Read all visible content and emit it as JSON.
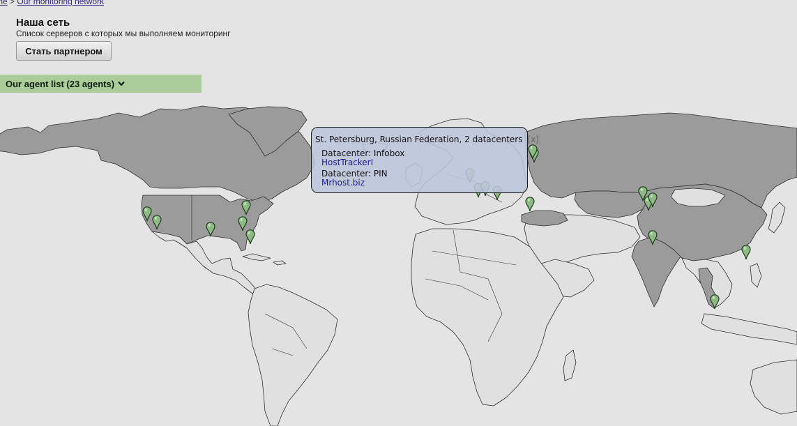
{
  "breadcrumb": {
    "home": "me",
    "separator": ">",
    "current": "Our monitoring network"
  },
  "header": {
    "title": "Наша сеть",
    "subtitle": "Список серверов с которых мы выполняем мониторинг",
    "partner_button": "Стать партнером"
  },
  "agent_list": {
    "label": "Our agent list (23 agents)",
    "icon": "chevron-down-icon"
  },
  "popup": {
    "title": "St. Petersburg, Russian Federation, 2 datacenters",
    "close": "[x]",
    "datacenters": [
      {
        "label": "Datacenter: Infobox",
        "link": "HostTrackerI"
      },
      {
        "label": "Datacenter: PIN",
        "link": "Mrhost.biz"
      }
    ]
  },
  "map": {
    "colors": {
      "ocean": "#e4e4e4",
      "land": "#e0e0e0",
      "highlighted": "#9b9b9b",
      "border": "#2e2e2e",
      "marker_fill": "#8dba85",
      "marker_stroke": "#1d3a1d",
      "accent_green": "#a9cc98"
    },
    "highlighted_countries": [
      "Canada",
      "United States",
      "Russian Federation",
      "China",
      "Kazakhstan",
      "India",
      "Turkey",
      "Thailand",
      "Greenland"
    ],
    "marker_icon": "map-pin-icon",
    "marker_count": 23
  }
}
